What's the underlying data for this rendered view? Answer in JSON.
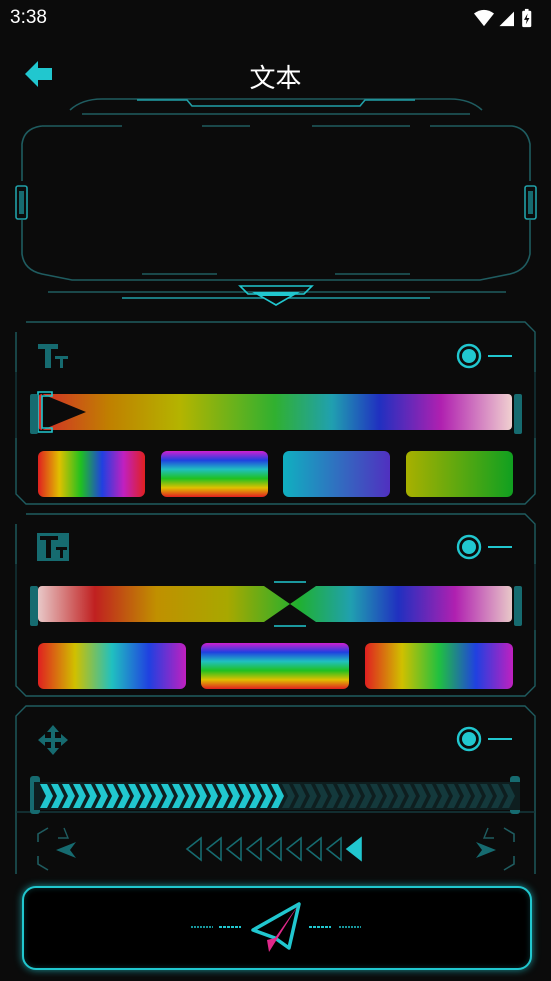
{
  "status_bar": {
    "time": "3:38",
    "icons": [
      "wifi-icon",
      "cellular-signal-icon",
      "battery-charging-icon"
    ]
  },
  "app_bar": {
    "title": "文本",
    "back_icon": "arrow-left-icon"
  },
  "colors": {
    "accent": "#21c7cf",
    "accent_dark": "#166b70",
    "frame": "#1f5c60",
    "background": "#0b0b0b"
  },
  "panels": [
    {
      "icon": "text-size-icon",
      "toggle_on": true,
      "slider_style": "rainbow-fade-left",
      "swatches": [
        "rainbow-horizontal",
        "rainbow-stripes",
        "cyan-violet",
        "olive-green"
      ]
    },
    {
      "icon": "text-size-filled-icon",
      "toggle_on": true,
      "slider_style": "rainbow-pinched-center",
      "swatches": [
        "rainbow-horizontal",
        "rainbow-stripes",
        "rainbow-horizontal-reverse"
      ]
    },
    {
      "icon": "move-arrows-icon",
      "toggle_on": true,
      "speed_fraction": 0.5,
      "direction_icons": [
        "arrow-left-icon",
        "triangle-left-row-icon",
        "arrow-right-icon"
      ]
    }
  ],
  "send_button": {
    "icon": "paper-plane-icon"
  }
}
